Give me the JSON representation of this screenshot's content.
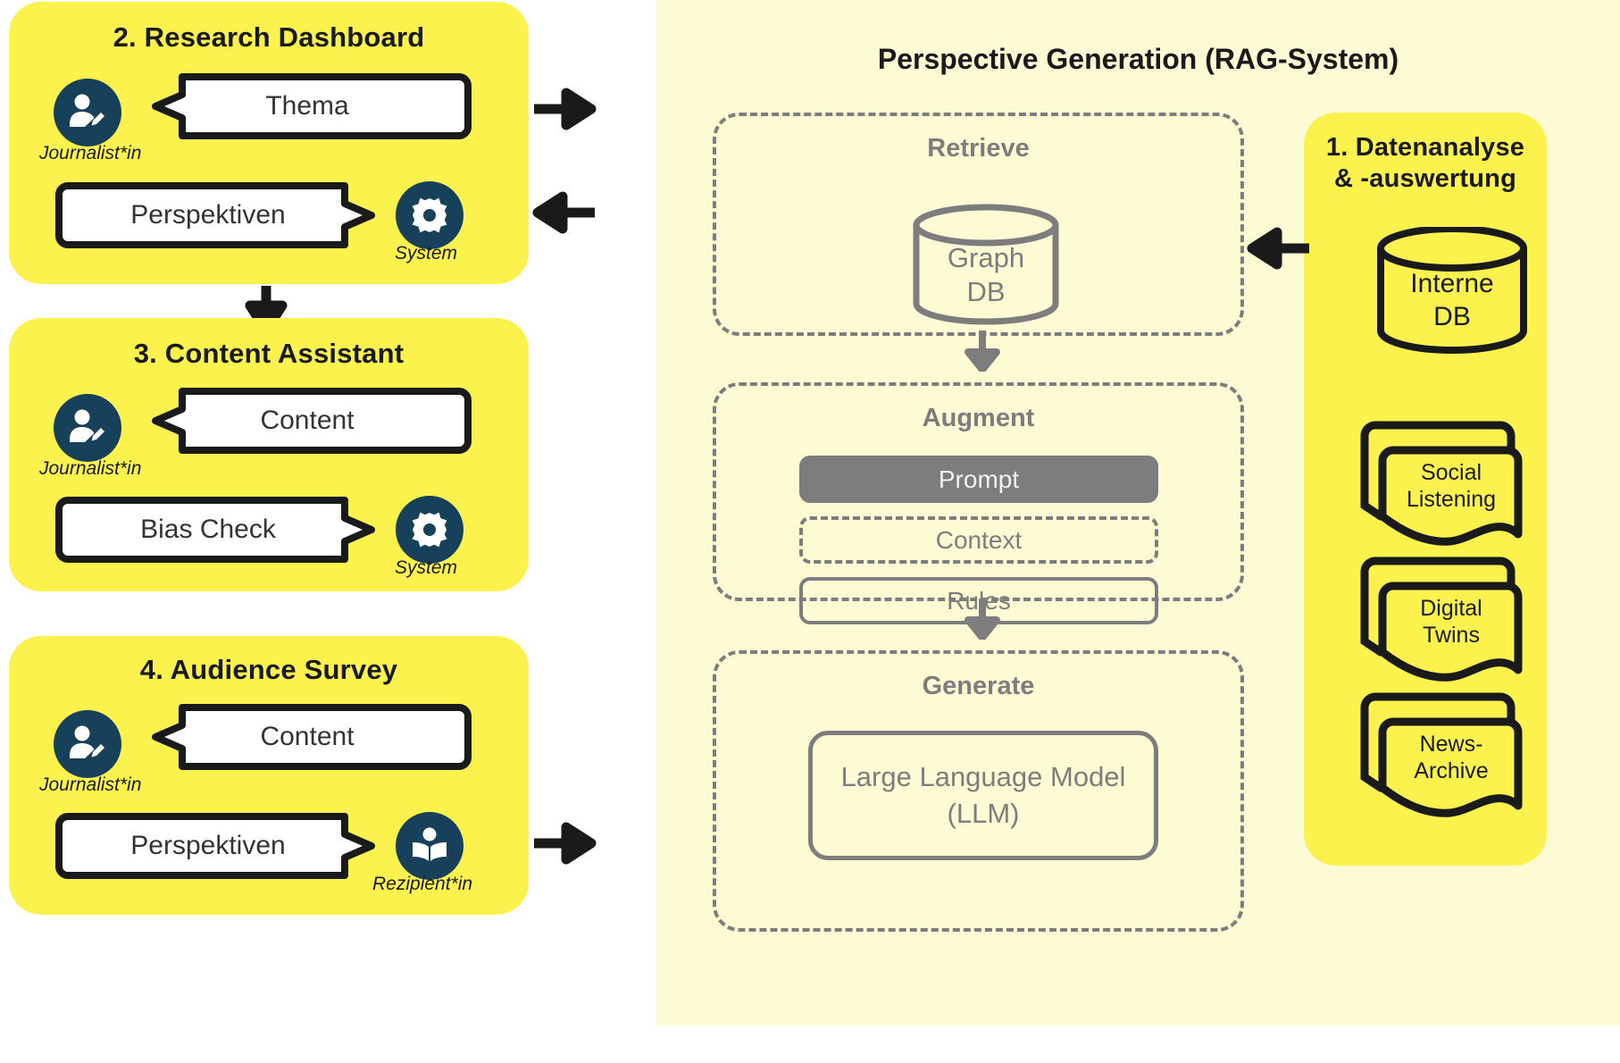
{
  "colors": {
    "yellow_panel": "#fbf24e",
    "pale_panel": "#fdfbd4",
    "actor_circle": "#17405a",
    "gray_stroke": "#7d7d7d",
    "black_stroke": "#1a1a1a",
    "msgbox_fill": "#ffffff"
  },
  "stages": [
    {
      "id": "research-dashboard",
      "title": "2. Research Dashboard",
      "rows": [
        {
          "actor_label": "Journalist*in",
          "actor_icon": "person-writing-icon",
          "message": "Thema",
          "direction": "in"
        },
        {
          "actor_label": "System",
          "actor_icon": "gear-icon",
          "message": "Perspektiven",
          "direction": "out"
        }
      ]
    },
    {
      "id": "content-assistant",
      "title": "3. Content Assistant",
      "rows": [
        {
          "actor_label": "Journalist*in",
          "actor_icon": "person-writing-icon",
          "message": "Content",
          "direction": "in"
        },
        {
          "actor_label": "System",
          "actor_icon": "gear-icon",
          "message": "Bias Check",
          "direction": "out"
        }
      ]
    },
    {
      "id": "audience-survey",
      "title": "4. Audience Survey",
      "rows": [
        {
          "actor_label": "Journalist*in",
          "actor_icon": "person-writing-icon",
          "message": "Content",
          "direction": "in"
        },
        {
          "actor_label": "Rezipient*in",
          "actor_icon": "person-reading-book-icon",
          "message": "Perspektiven",
          "direction": "out"
        }
      ]
    }
  ],
  "rag": {
    "title": "Perspective Generation (RAG-System)",
    "retrieve": {
      "title": "Retrieve",
      "db_label_line1": "Graph",
      "db_label_line2": "DB"
    },
    "augment": {
      "title": "Augment",
      "rows": [
        {
          "label": "Prompt",
          "style": "filled"
        },
        {
          "label": "Context",
          "style": "dashed"
        },
        {
          "label": "Rules",
          "style": "solid"
        }
      ]
    },
    "generate": {
      "title": "Generate",
      "model_line1": "Large Language Model",
      "model_line2": "(LLM)"
    }
  },
  "data_sources": {
    "title_line1": "1. Datenanalyse",
    "title_line2": "& -auswertung",
    "items": [
      {
        "type": "cylinder",
        "icon": "database-cylinder-icon",
        "line1": "Interne",
        "line2": "DB"
      },
      {
        "type": "docstack",
        "icon": "document-stack-icon",
        "line1": "Social",
        "line2": "Listening"
      },
      {
        "type": "docstack",
        "icon": "document-stack-icon",
        "line1": "Digital",
        "line2": "Twins"
      },
      {
        "type": "docstack",
        "icon": "document-stack-icon",
        "line1": "News-",
        "line2": "Archive"
      }
    ]
  },
  "arrows": [
    {
      "name": "arrow-dashboard-to-rag",
      "direction": "right"
    },
    {
      "name": "arrow-rag-to-dashboard",
      "direction": "left"
    },
    {
      "name": "arrow-dashboard-to-assistant",
      "direction": "down"
    },
    {
      "name": "arrow-survey-to-rag",
      "direction": "right"
    },
    {
      "name": "arrow-sources-to-retrieve",
      "direction": "left"
    },
    {
      "name": "arrow-retrieve-to-augment",
      "direction": "down"
    },
    {
      "name": "arrow-augment-to-generate",
      "direction": "down"
    }
  ]
}
